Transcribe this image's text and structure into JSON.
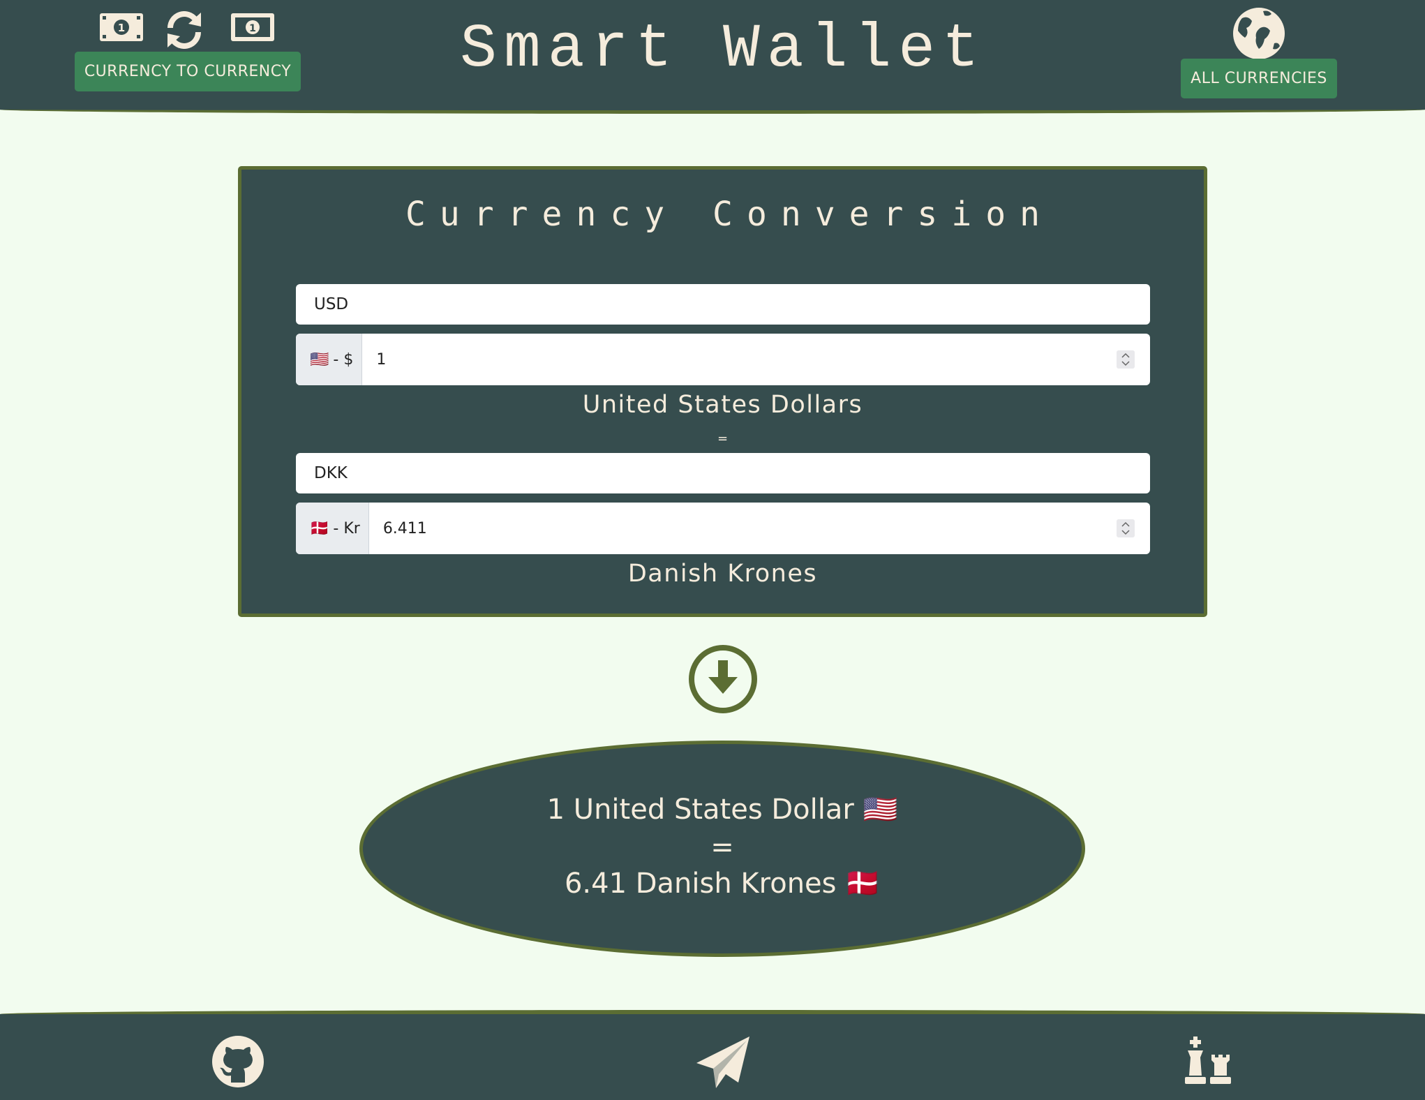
{
  "header": {
    "title": "Smart Wallet",
    "currency_to_currency_label": "CURRENCY TO CURRENCY",
    "all_currencies_label": "ALL CURRENCIES"
  },
  "converter": {
    "title": "Currency Conversion",
    "from": {
      "code": "USD",
      "flag": "🇺🇸",
      "symbol": "- $",
      "amount": "1",
      "name": "United States Dollars"
    },
    "equals": "=",
    "to": {
      "code": "DKK",
      "flag": "🇩🇰",
      "symbol": "- Kr",
      "amount": "6.411",
      "name": "Danish Krones"
    }
  },
  "result": {
    "line1": "1 United States Dollar 🇺🇸",
    "equals": "=",
    "line2": "6.41 Danish Krones 🇩🇰"
  },
  "footer": {
    "icons": [
      "github-icon",
      "paper-plane-icon",
      "chess-icon"
    ]
  },
  "colors": {
    "dark": "#364d4e",
    "border_green": "#5b6d33",
    "button_green": "#3c8558",
    "cream": "#f5ecdc",
    "background": "#f2fcef"
  }
}
